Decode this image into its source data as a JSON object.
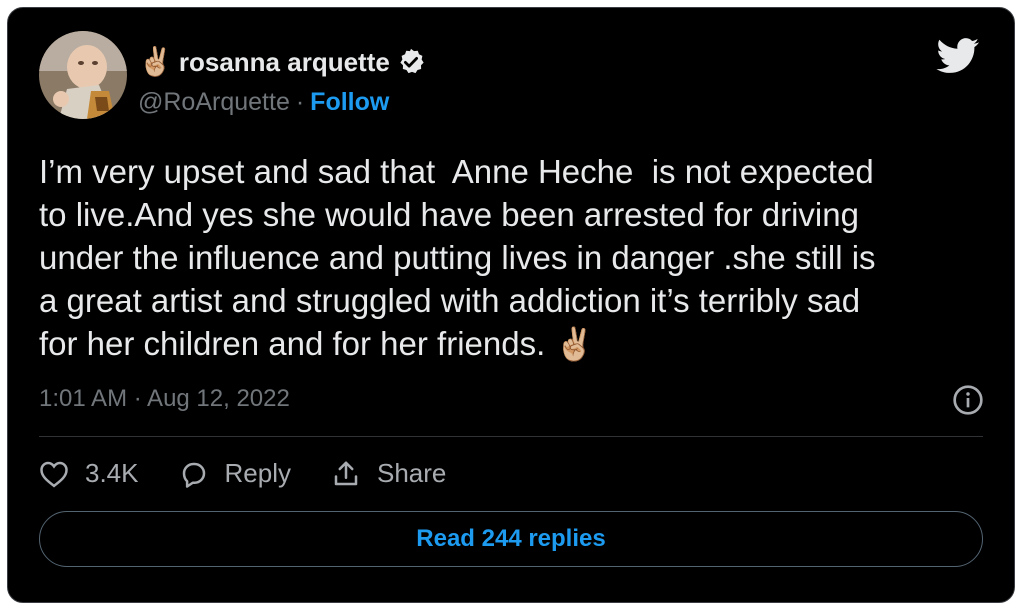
{
  "author": {
    "name_emoji": "✌🏼",
    "name": "rosanna arquette",
    "handle": "@RoArquette",
    "separator": "·",
    "follow_label": "Follow"
  },
  "tweet": {
    "text": "I’m very upset and sad that  Anne Heche  is not expected\nto live.And yes she would have been arrested for driving\nunder the influence and putting lives in danger .she still is\na great artist and struggled with addiction it’s terribly sad\nfor her children and for her friends. ",
    "trailing_emoji": "✌🏼",
    "timestamp": "1:01 AM · Aug 12, 2022"
  },
  "actions": {
    "like_count": "3.4K",
    "reply_label": "Reply",
    "share_label": "Share"
  },
  "read_replies_label": "Read 244 replies",
  "colors": {
    "background": "#000000",
    "accent": "#1d9bf0",
    "text": "#e7e9ea",
    "muted": "#71767b"
  },
  "icons": [
    "avatar-photo",
    "verified-badge-icon",
    "twitter-bird-icon",
    "info-icon",
    "heart-icon",
    "reply-bubble-icon",
    "share-icon"
  ]
}
